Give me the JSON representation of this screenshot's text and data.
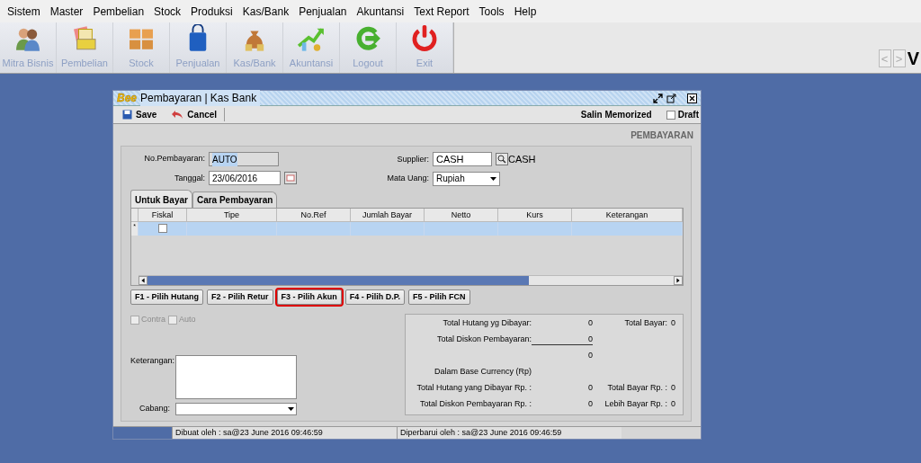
{
  "menu": [
    {
      "label": "Sistem"
    },
    {
      "label": "Master"
    },
    {
      "label": "Pembelian"
    },
    {
      "label": "Stock"
    },
    {
      "label": "Produksi"
    },
    {
      "label": "Kas/Bank"
    },
    {
      "label": "Penjualan"
    },
    {
      "label": "Akuntansi"
    },
    {
      "label": "Text Report"
    },
    {
      "label": "Tools"
    },
    {
      "label": "Help"
    }
  ],
  "toolbar": [
    {
      "label": "Mitra Bisnis",
      "kind": "people"
    },
    {
      "label": "Pembelian",
      "kind": "ledger"
    },
    {
      "label": "Stock",
      "kind": "boxes"
    },
    {
      "label": "Penjualan",
      "kind": "bag"
    },
    {
      "label": "Kas/Bank",
      "kind": "moneybag"
    },
    {
      "label": "Akuntansi",
      "kind": "chart"
    },
    {
      "label": "Logout",
      "kind": "logout"
    },
    {
      "label": "Exit",
      "kind": "power"
    }
  ],
  "nav": {
    "prev": "<",
    "next": ">",
    "letter": "V"
  },
  "window": {
    "logo": "Bee",
    "title": "Pembayaran | Kas Bank",
    "actions": [
      {
        "label": "Save",
        "kind": "save"
      },
      {
        "label": "Cancel",
        "kind": "cancel"
      }
    ],
    "salin": "Salin Memorized",
    "draft": {
      "label": "Draft",
      "checked": false
    },
    "header": "PEMBAYARAN",
    "fields": {
      "no_pembayaran": {
        "label": "No.Pembayaran:",
        "value": "AUTO"
      },
      "tanggal": {
        "label": "Tanggal:",
        "value": "23/06/2016"
      },
      "supplier": {
        "label": "Supplier:",
        "value": "CASH",
        "name": "CASH"
      },
      "mata_uang": {
        "label": "Mata Uang:",
        "value": "Rupiah"
      }
    },
    "tabs": [
      {
        "label": "Untuk Bayar",
        "selected": true
      },
      {
        "label": "Cara Pembayaran",
        "selected": false
      }
    ],
    "table": {
      "columns": [
        "Fiskal",
        "Tipe",
        "No.Ref",
        "Jumlah Bayar",
        "Netto",
        "Kurs",
        "Keterangan"
      ],
      "rows": [
        {
          "marker": "*",
          "fiskal": false,
          "selected": true
        }
      ]
    },
    "function_buttons": [
      {
        "label": "F1 - Pilih Hutang",
        "highlighted": false
      },
      {
        "label": "F2 - Pilih Retur",
        "highlighted": false
      },
      {
        "label": "F3 - Pilih Akun",
        "highlighted": true
      },
      {
        "label": "F4 - Pilih D.P.",
        "highlighted": false
      },
      {
        "label": "F5 - Pilih FCN",
        "highlighted": false
      }
    ],
    "options": [
      {
        "label": "Contra",
        "checked": false,
        "disabled": true
      },
      {
        "label": "Auto",
        "checked": false,
        "disabled": true
      }
    ],
    "keterangan_label": "Keterangan:",
    "cabang_label": "Cabang:",
    "summary": [
      {
        "label": "Total Hutang yg Dibayar:",
        "value": "0",
        "extra_label": "Total Bayar:",
        "extra_value": "0"
      },
      {
        "label": "Total Diskon Pembayaran:",
        "value": "0",
        "rule_below": true
      },
      {
        "value": "0"
      },
      {
        "label": "Dalam Base Currency (Rp)"
      },
      {
        "label": "Total Hutang yang Dibayar Rp. :",
        "value": "0",
        "extra_label": "Total Bayar Rp. :",
        "extra_value": "0"
      },
      {
        "label": "Total Diskon Pembayaran Rp. :",
        "value": "0",
        "extra_label": "Lebih Bayar Rp. :",
        "extra_value": "0"
      }
    ],
    "status": [
      "Dibuat oleh : sa@23 June 2016  09:46:59",
      "Diperbarui oleh : sa@23 June 2016  09:46:59"
    ]
  }
}
